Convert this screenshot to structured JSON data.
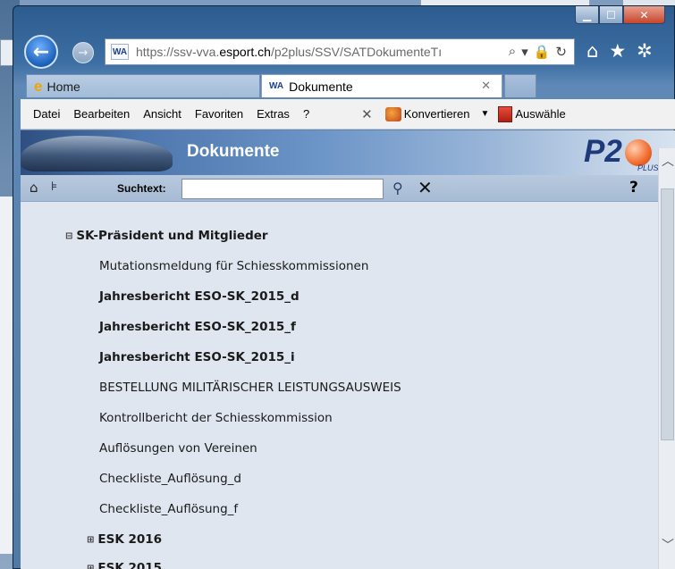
{
  "browser": {
    "url_prefix": "https://ssv-vva.",
    "url_host": "esport.ch",
    "url_path": "/p2plus/SSV/SATDokumenteTı",
    "favicon_label": "WA",
    "tabs": [
      {
        "label": "Home"
      },
      {
        "label": "Dokumente"
      }
    ],
    "menu": [
      "Datei",
      "Bearbeiten",
      "Ansicht",
      "Favoriten",
      "Extras",
      "?"
    ],
    "konvertieren_label": "Konvertieren",
    "auswaehlen_label": "Auswähle"
  },
  "page": {
    "banner_title": "Dokumente",
    "logo_text": "P2",
    "logo_sub": "PLUS",
    "search_label": "Suchtext:",
    "search_value": "",
    "help_label": "?"
  },
  "tree": {
    "section1": {
      "label": "SK-Präsident und Mitglieder",
      "state": "expanded"
    },
    "items": [
      {
        "label": "Mutationsmeldung für Schiesskommissionen",
        "bold": false
      },
      {
        "label": "Jahresbericht ESO-SK_2015_d",
        "bold": true
      },
      {
        "label": "Jahresbericht ESO-SK_2015_f",
        "bold": true
      },
      {
        "label": "Jahresbericht ESO-SK_2015_i",
        "bold": true
      },
      {
        "label": "BESTELLUNG MILITÄRISCHER LEISTUNGSAUSWEIS",
        "bold": false
      },
      {
        "label": "Kontrollbericht der Schiesskommission",
        "bold": false
      },
      {
        "label": "Auflösungen von Vereinen",
        "bold": false
      },
      {
        "label": "Checkliste_Auflösung_d",
        "bold": false
      },
      {
        "label": "Checkliste_Auflösung_f",
        "bold": false
      }
    ],
    "section2": {
      "label": "ESK 2016",
      "state": "collapsed"
    },
    "section3": {
      "label": "ESK 2015",
      "state": "collapsed"
    }
  }
}
